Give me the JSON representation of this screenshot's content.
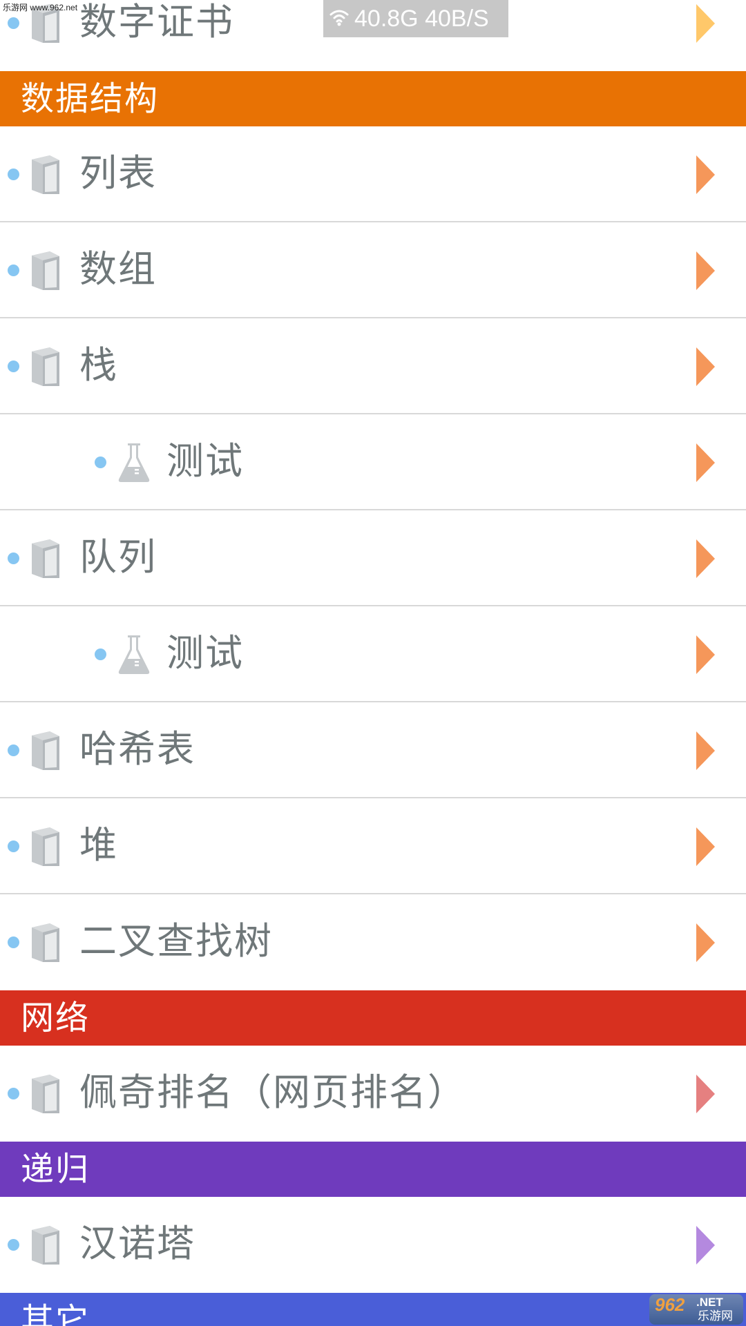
{
  "status_bar": {
    "signal_icon": "wifi-icon",
    "text": "40.8G 40B/S"
  },
  "watermark": {
    "top_text": "乐游网 www.962.net",
    "bottom_number": "962",
    "bottom_net": ".NET",
    "bottom_cn": "乐游网"
  },
  "colors": {
    "accent_dot": "#86c6f2",
    "row_text": "#6f7779",
    "section_data_structures": "#e87204",
    "section_network": "#d7301f",
    "section_recursion": "#6f3bbd",
    "section_other": "#4a5ed8",
    "chevron_yellow": "#ffc86a",
    "chevron_orange": "#f5975a",
    "chevron_pink": "#e58080",
    "chevron_purple": "#b489df"
  },
  "rows": [
    {
      "kind": "item",
      "level": 0,
      "icon": "book-icon",
      "label": "数字证书",
      "chevron_color": "#ffc86a"
    },
    {
      "kind": "section",
      "label": "数据结构",
      "color": "#e87204"
    },
    {
      "kind": "item",
      "level": 0,
      "icon": "book-icon",
      "label": "列表",
      "chevron_color": "#f5975a"
    },
    {
      "kind": "item",
      "level": 0,
      "icon": "book-icon",
      "label": "数组",
      "chevron_color": "#f5975a"
    },
    {
      "kind": "item",
      "level": 0,
      "icon": "book-icon",
      "label": "栈",
      "chevron_color": "#f5975a"
    },
    {
      "kind": "item",
      "level": 1,
      "icon": "flask-icon",
      "label": "测试",
      "chevron_color": "#f5975a"
    },
    {
      "kind": "item",
      "level": 0,
      "icon": "book-icon",
      "label": "队列",
      "chevron_color": "#f5975a"
    },
    {
      "kind": "item",
      "level": 1,
      "icon": "flask-icon",
      "label": "测试",
      "chevron_color": "#f5975a"
    },
    {
      "kind": "item",
      "level": 0,
      "icon": "book-icon",
      "label": "哈希表",
      "chevron_color": "#f5975a"
    },
    {
      "kind": "item",
      "level": 0,
      "icon": "book-icon",
      "label": "堆",
      "chevron_color": "#f5975a"
    },
    {
      "kind": "item",
      "level": 0,
      "icon": "book-icon",
      "label": "二叉查找树",
      "chevron_color": "#f5975a"
    },
    {
      "kind": "section",
      "label": "网络",
      "color": "#d7301f"
    },
    {
      "kind": "item",
      "level": 0,
      "icon": "book-icon",
      "label": "佩奇排名（网页排名）",
      "chevron_color": "#e58080"
    },
    {
      "kind": "section",
      "label": "递归",
      "color": "#6f3bbd"
    },
    {
      "kind": "item",
      "level": 0,
      "icon": "book-icon",
      "label": "汉诺塔",
      "chevron_color": "#b489df"
    },
    {
      "kind": "section",
      "label": "其它",
      "color": "#4a5ed8"
    }
  ]
}
